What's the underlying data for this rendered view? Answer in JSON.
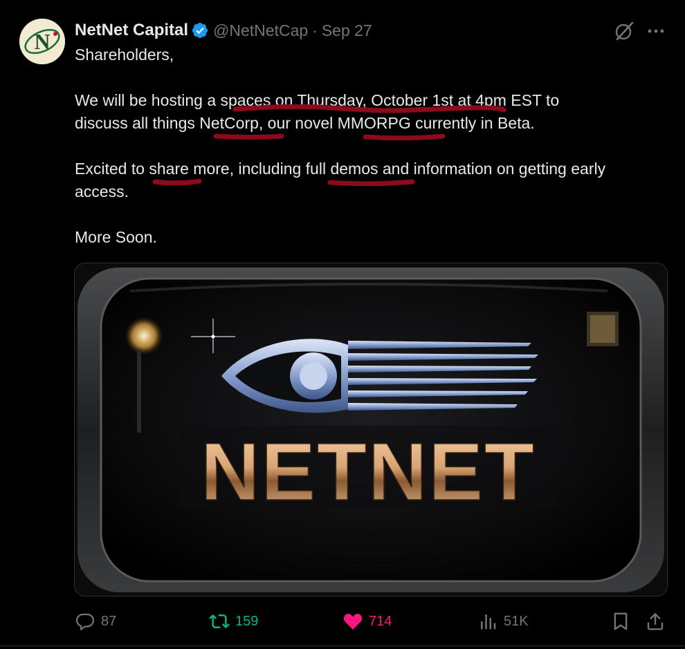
{
  "author": {
    "name": "NetNet Capital",
    "handle": "@NetNetCap",
    "separator": "·",
    "date": "Sep 27",
    "avatar_letter": "N"
  },
  "tweet": {
    "lines": [
      "Shareholders,",
      "We will be hosting a spaces on Thursday, October 1st at 4pm EST to",
      "discuss all things NetCorp, our novel MMORPG currently in Beta.",
      "Excited to share more, including full demos and information on getting early",
      "access.",
      "More Soon."
    ],
    "underline_color": "#8b0a1c"
  },
  "media": {
    "logo_text": "NETNET"
  },
  "actions": {
    "replies": "87",
    "reposts": "159",
    "likes": "714",
    "views": "51K"
  },
  "colors": {
    "background": "#000000",
    "text": "#e7e9ea",
    "muted": "#71767b",
    "verified": "#1d9bf0",
    "repost": "#00ba7c",
    "like": "#f91880"
  }
}
